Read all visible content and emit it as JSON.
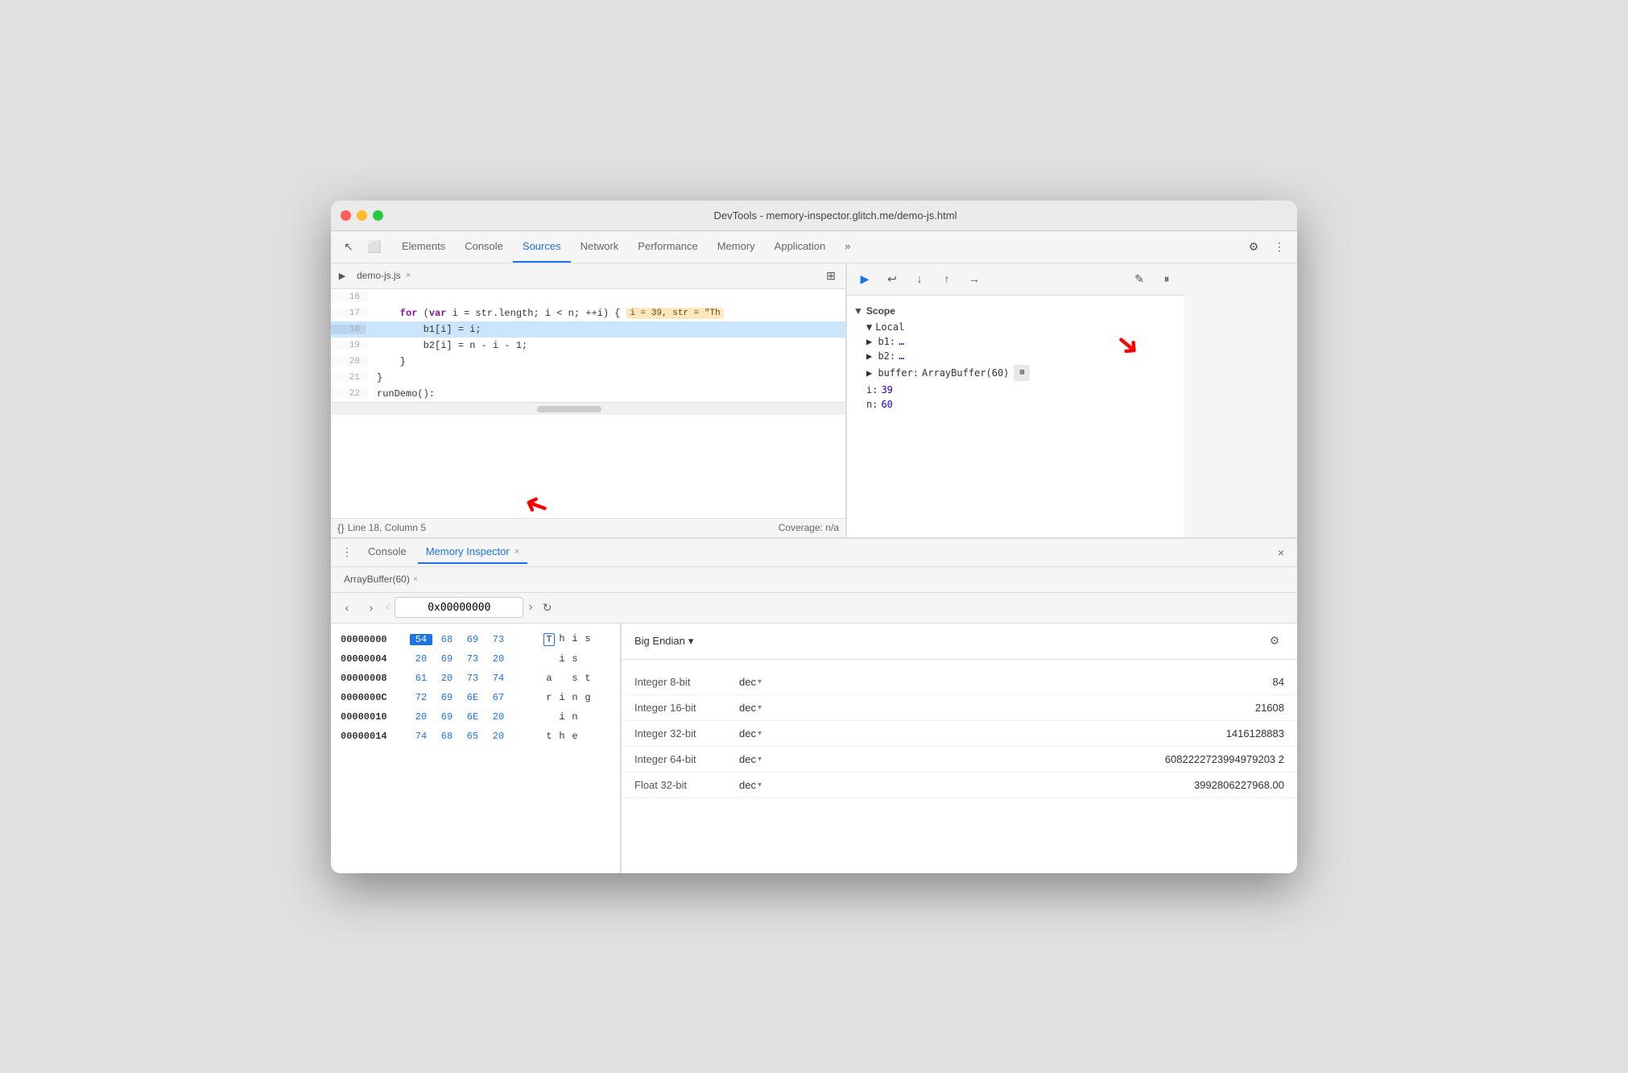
{
  "window": {
    "title": "DevTools - memory-inspector.glitch.me/demo-js.html"
  },
  "nav": {
    "tabs": [
      {
        "label": "Elements",
        "active": false
      },
      {
        "label": "Console",
        "active": false
      },
      {
        "label": "Sources",
        "active": true
      },
      {
        "label": "Network",
        "active": false
      },
      {
        "label": "Performance",
        "active": false
      },
      {
        "label": "Memory",
        "active": false
      },
      {
        "label": "Application",
        "active": false
      }
    ],
    "more_label": "»"
  },
  "file_tab": {
    "name": "demo-js.js",
    "close": "×"
  },
  "code": {
    "lines": [
      {
        "num": "16",
        "content": "",
        "highlighted": false
      },
      {
        "num": "17",
        "content": "    for (var i = str.length; i < n; ++i) {",
        "highlighted": false,
        "inline_val": "i = 39, str = \"Th"
      },
      {
        "num": "18",
        "content": "        b1[i] = i;",
        "highlighted": true
      },
      {
        "num": "19",
        "content": "        b2[i] = n - i - 1;",
        "highlighted": false
      },
      {
        "num": "20",
        "content": "    }",
        "highlighted": false
      },
      {
        "num": "21",
        "content": "}",
        "highlighted": false
      },
      {
        "num": "22",
        "content": "runDemo();",
        "highlighted": false
      }
    ]
  },
  "status_bar": {
    "format_icon": "{}",
    "position": "Line 18, Column 5",
    "coverage": "Coverage: n/a"
  },
  "bottom_tabs": {
    "menu_icon": "⋮",
    "console_label": "Console",
    "memory_inspector_label": "Memory Inspector",
    "active": "memory_inspector",
    "close": "×",
    "close_panel": "×"
  },
  "memory_inspector": {
    "tab_label": "ArrayBuffer(60)",
    "tab_close": "×",
    "nav_back": "‹",
    "nav_forward": "›",
    "address": "0x00000000",
    "refresh": "↻",
    "hex_rows": [
      {
        "addr": "00000000",
        "bytes": [
          "54",
          "68",
          "69",
          "73"
        ],
        "chars": [
          "T",
          "h",
          "i",
          "s"
        ],
        "selected_byte": 0,
        "selected_char": 0
      },
      {
        "addr": "00000004",
        "bytes": [
          "20",
          "69",
          "73",
          "20"
        ],
        "chars": [
          " ",
          "i",
          "s",
          " "
        ],
        "selected_byte": -1,
        "selected_char": -1
      },
      {
        "addr": "00000008",
        "bytes": [
          "61",
          "20",
          "73",
          "74"
        ],
        "chars": [
          "a",
          " ",
          "s",
          "t"
        ],
        "selected_byte": -1,
        "selected_char": -1
      },
      {
        "addr": "0000000C",
        "bytes": [
          "72",
          "69",
          "6E",
          "67"
        ],
        "chars": [
          "r",
          "i",
          "n",
          "g"
        ],
        "selected_byte": -1,
        "selected_char": -1
      },
      {
        "addr": "00000010",
        "bytes": [
          "20",
          "69",
          "6E",
          "20"
        ],
        "chars": [
          " ",
          "i",
          "n",
          " "
        ],
        "selected_byte": -1,
        "selected_char": -1
      },
      {
        "addr": "00000014",
        "bytes": [
          "74",
          "68",
          "65",
          "20"
        ],
        "chars": [
          "t",
          "h",
          "e",
          " "
        ],
        "selected_byte": -1,
        "selected_char": -1
      }
    ]
  },
  "inspector_values": {
    "endian": "Big Endian",
    "endian_arrow": "▾",
    "gear": "⚙",
    "rows": [
      {
        "type": "Integer 8-bit",
        "format": "dec",
        "value": "84"
      },
      {
        "type": "Integer 16-bit",
        "format": "dec",
        "value": "21608"
      },
      {
        "type": "Integer 32-bit",
        "format": "dec",
        "value": "1416128883"
      },
      {
        "type": "Integer 64-bit",
        "format": "dec",
        "value": "6082222723994979203 2"
      },
      {
        "type": "Float 32-bit",
        "format": "dec",
        "value": "3992806227968.00"
      }
    ]
  },
  "scope": {
    "title": "Scope",
    "local_title": "Local",
    "items": [
      {
        "key": "▶ b1:",
        "val": "…"
      },
      {
        "key": "▶ b2:",
        "val": "…"
      },
      {
        "key": "▶ buffer:",
        "val": "ArrayBuffer(60)",
        "has_icon": true
      },
      {
        "key": "i:",
        "val": "39"
      },
      {
        "key": "n:",
        "val": "60"
      }
    ]
  },
  "debug_toolbar": {
    "buttons": [
      "▶",
      "↩",
      "↓",
      "↑",
      "→",
      "✎",
      "⏸"
    ]
  }
}
